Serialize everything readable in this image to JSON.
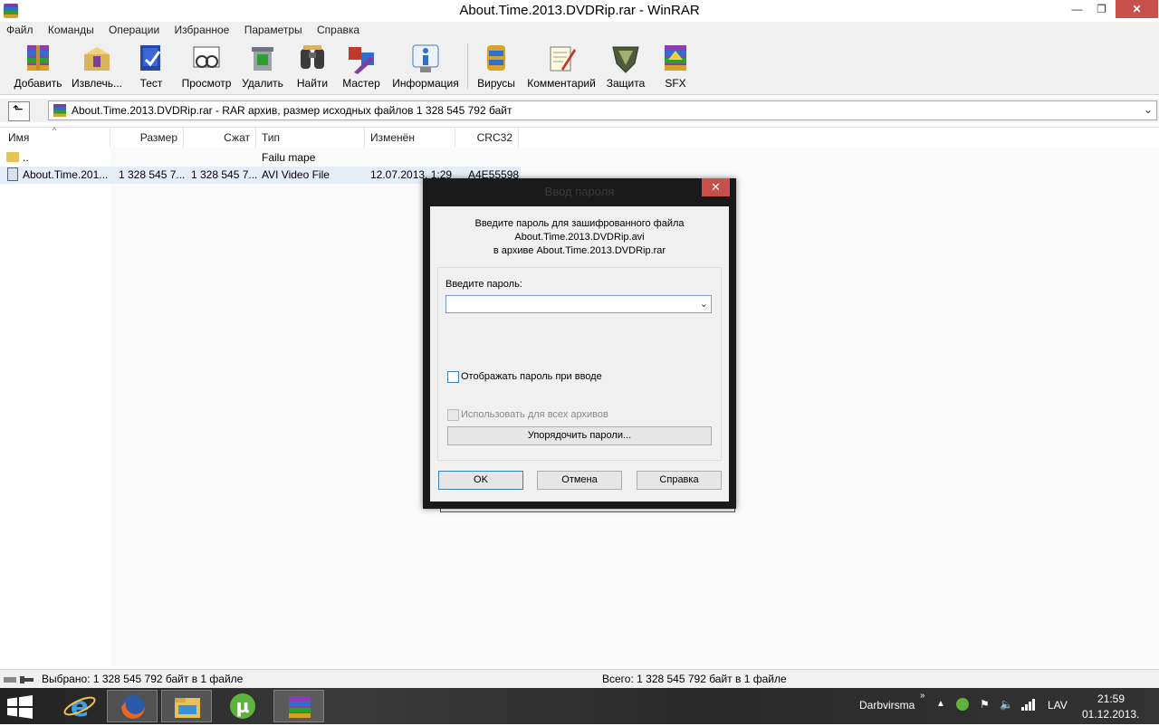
{
  "window": {
    "title": "About.Time.2013.DVDRip.rar - WinRAR"
  },
  "menu": [
    "Файл",
    "Команды",
    "Операции",
    "Избранное",
    "Параметры",
    "Справка"
  ],
  "toolbar": [
    {
      "label": "Добавить",
      "icon": "add-archive-icon"
    },
    {
      "label": "Извлечь...",
      "icon": "extract-icon"
    },
    {
      "label": "Тест",
      "icon": "test-icon"
    },
    {
      "label": "Просмотр",
      "icon": "view-icon"
    },
    {
      "label": "Удалить",
      "icon": "delete-icon"
    },
    {
      "label": "Найти",
      "icon": "find-icon"
    },
    {
      "label": "Мастер",
      "icon": "wizard-icon"
    },
    {
      "label": "Информация",
      "icon": "info-icon"
    },
    {
      "label": "Вирусы",
      "icon": "virus-scan-icon"
    },
    {
      "label": "Комментарий",
      "icon": "comment-icon"
    },
    {
      "label": "Защита",
      "icon": "protect-icon"
    },
    {
      "label": "SFX",
      "icon": "sfx-icon"
    }
  ],
  "address": {
    "text": "About.Time.2013.DVDRip.rar - RAR архив, размер исходных файлов 1 328 545 792 байт"
  },
  "columns": [
    "Имя",
    "Размер",
    "Сжат",
    "Тип",
    "Изменён",
    "CRC32"
  ],
  "rows": [
    {
      "name": "..",
      "size": "",
      "packed": "",
      "type": "Failu mape",
      "modified": "",
      "crc": ""
    },
    {
      "name": "About.Time.201...",
      "size": "1 328 545 7...",
      "packed": "1 328 545 7...",
      "type": "AVI Video File",
      "modified": "12.07.2013. 1:29",
      "crc": "A4E55598"
    }
  ],
  "status": {
    "selected": "Выбрано: 1 328 545 792 байт в 1 файле",
    "total": "Всего: 1 328 545 792 байт в 1 файле"
  },
  "dialog": {
    "title": "Ввод пароля",
    "line1": "Введите пароль для зашифрованного файла",
    "line2": "About.Time.2013.DVDRip.avi",
    "line3": "в архиве About.Time.2013.DVDRip.rar",
    "password_label": "Введите пароль:",
    "password_value": "",
    "show_password": "Отображать пароль при вводе",
    "use_for_all": "Использовать для всех архивов",
    "organize": "Упорядочить пароли...",
    "ok": "OK",
    "cancel": "Отмена",
    "help": "Справка"
  },
  "taskbar": {
    "user": "Darbvirsma",
    "lang": "LAV",
    "time": "21:59",
    "date": "01.12.2013."
  },
  "colors": {
    "close_button": "#c7504a",
    "selection": "#e5eef8"
  }
}
